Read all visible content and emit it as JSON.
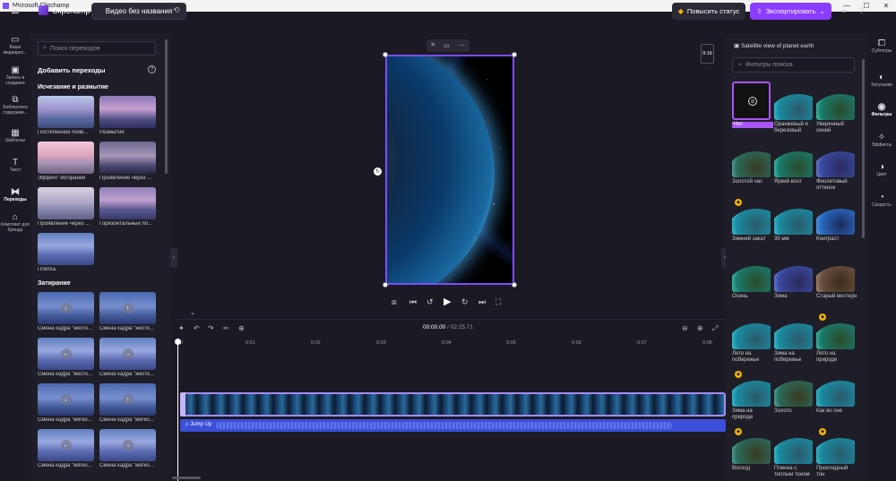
{
  "window": {
    "title": "Microsoft Clipchamp",
    "minimize": "—",
    "maximize": "☐",
    "close": "✕"
  },
  "topbar": {
    "logo": "Clipchamp",
    "project_name": "Видео без названия",
    "upgrade_label": "Повысить статус",
    "export_label": "Экспортировать"
  },
  "left_rail": {
    "items": [
      {
        "icon": "media-icon",
        "label": "Ваше медиарес..."
      },
      {
        "icon": "record-icon",
        "label": "Запись и создание"
      },
      {
        "icon": "library-icon",
        "label": "Библиотека содержим..."
      },
      {
        "icon": "templates-icon",
        "label": "Шаблоны"
      },
      {
        "icon": "text-icon",
        "label": "Текст"
      },
      {
        "icon": "transitions-icon",
        "label": "Переходы"
      },
      {
        "icon": "brand-kit-icon",
        "label": "Комплект для бренда"
      }
    ]
  },
  "transitions": {
    "search_placeholder": "Поиск переходов",
    "title": "Добавить переходы",
    "section_fade": "Исчезание и размытие",
    "section_wipe": "Затирание",
    "fade_items": [
      "Постепенное появ...",
      "Размытие",
      "Эффект обгорания",
      "Проявление через ...",
      "Проявление через ...",
      "Горизонтальные по...",
      "Плитка"
    ],
    "wipe_items": [
      "Смена кадра \"жестк...",
      "Смена кадра \"жестк...",
      "Смена кадра \"жестк...",
      "Смена кадра \"жестк...",
      "Смена кадра \"мягко...",
      "Смена кадра \"мягко...",
      "Смена кадра \"мягко...",
      "Смена кадра \"мягко..."
    ]
  },
  "preview": {
    "aspect_ratio": "9:16"
  },
  "timeline": {
    "current_time": "00:00.00",
    "duration": " / 02:25.71",
    "ruler": [
      "0",
      "0:01",
      "0:02",
      "0:03",
      "0:04",
      "0:05",
      "0:06",
      "0:07",
      "0:08"
    ],
    "audio_label": "Jump Up"
  },
  "filters": {
    "clip_title": "Satellite view of planet earth",
    "search_placeholder": "Фильтры поиска",
    "items": [
      {
        "label": "Нет",
        "style": "none",
        "selected": true,
        "premium": false
      },
      {
        "label": "Оранжевый и березовый",
        "style": "teal",
        "premium": false
      },
      {
        "label": "Уверенный синий",
        "style": "green",
        "premium": false
      },
      {
        "label": "Золотой час",
        "style": "gold",
        "premium": false
      },
      {
        "label": "Яркий влог",
        "style": "green",
        "premium": false
      },
      {
        "label": "Фиолетовый оттенок",
        "style": "violet",
        "premium": false
      },
      {
        "label": "Зимний закат",
        "style": "teal",
        "premium": true
      },
      {
        "label": "35 мм",
        "style": "teal",
        "premium": false
      },
      {
        "label": "Контраст",
        "style": "blue",
        "premium": false
      },
      {
        "label": "Осень",
        "style": "green",
        "premium": false
      },
      {
        "label": "Зима",
        "style": "violet",
        "premium": false
      },
      {
        "label": "Старый вестерн",
        "style": "sepia",
        "premium": false
      },
      {
        "label": "Лето на побережье",
        "style": "teal",
        "premium": false
      },
      {
        "label": "Зима на побережье",
        "style": "teal",
        "premium": false
      },
      {
        "label": "Лето на природе",
        "style": "green",
        "premium": true
      },
      {
        "label": "Зима на природе",
        "style": "teal",
        "premium": true
      },
      {
        "label": "Золото",
        "style": "gold",
        "premium": false
      },
      {
        "label": "Как во сне",
        "style": "teal",
        "premium": false
      },
      {
        "label": "Восход",
        "style": "gold",
        "premium": true
      },
      {
        "label": "Пленка с теплым тоном",
        "style": "teal",
        "premium": false
      },
      {
        "label": "Прохладный тон",
        "style": "teal",
        "premium": true
      }
    ]
  },
  "right_rail": {
    "items": [
      {
        "icon": "captions-icon",
        "label": "Субтитры"
      },
      {
        "icon": "fade-icon",
        "label": "Затухание"
      },
      {
        "icon": "filters-icon",
        "label": "Фильтры"
      },
      {
        "icon": "effects-icon",
        "label": "Эффекты"
      },
      {
        "icon": "color-icon",
        "label": "Цвет"
      },
      {
        "icon": "speed-icon",
        "label": "Скорость"
      }
    ]
  }
}
